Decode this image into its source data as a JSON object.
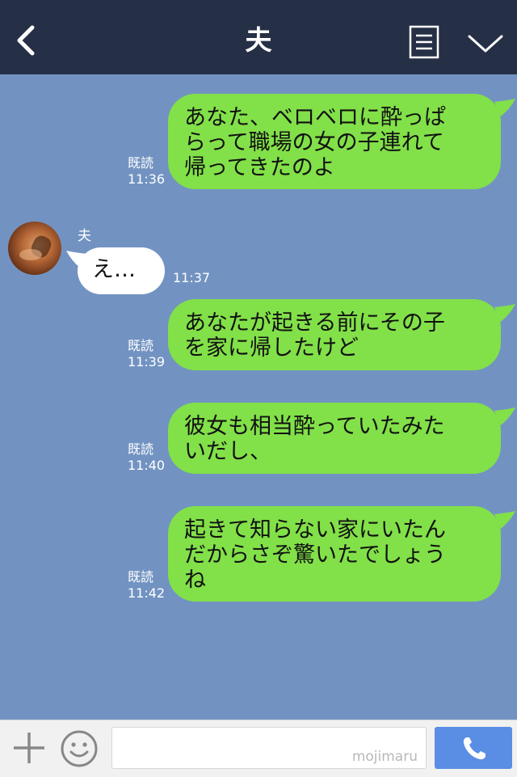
{
  "header": {
    "title": "夫"
  },
  "chat": {
    "sender_name": "夫",
    "messages": [
      {
        "from": "me",
        "text": "あなた、ベロベロに酔っぱ\nらって職場の女の子連れて\n帰ってきたのよ",
        "read": "既読",
        "time": "11:36"
      },
      {
        "from": "you",
        "text": "え…",
        "read": "",
        "time": "11:37"
      },
      {
        "from": "me",
        "text": "あなたが起きる前にその子\nを家に帰したけど",
        "read": "既読",
        "time": "11:39"
      },
      {
        "from": "me",
        "text": "彼女も相当酔っていたみた\nいだし、",
        "read": "既読",
        "time": "11:40"
      },
      {
        "from": "me",
        "text": "起きて知らない家にいたん\nだからさぞ驚いたでしょう\nね",
        "read": "既読",
        "time": "11:42"
      }
    ]
  },
  "footer": {
    "input_value": "",
    "watermark": "mojimaru"
  },
  "icons": {
    "back": "chevron-left-icon",
    "memo": "notes-icon",
    "down": "chevron-down-icon",
    "plus": "plus-icon",
    "emoji": "emoji-icon",
    "call": "phone-icon"
  },
  "colors": {
    "header": "#252f46",
    "background": "#7293c2",
    "my_bubble": "#82e049",
    "their_bubble": "#ffffff",
    "call_button": "#5a8de4",
    "footer": "#f1f1f1"
  }
}
